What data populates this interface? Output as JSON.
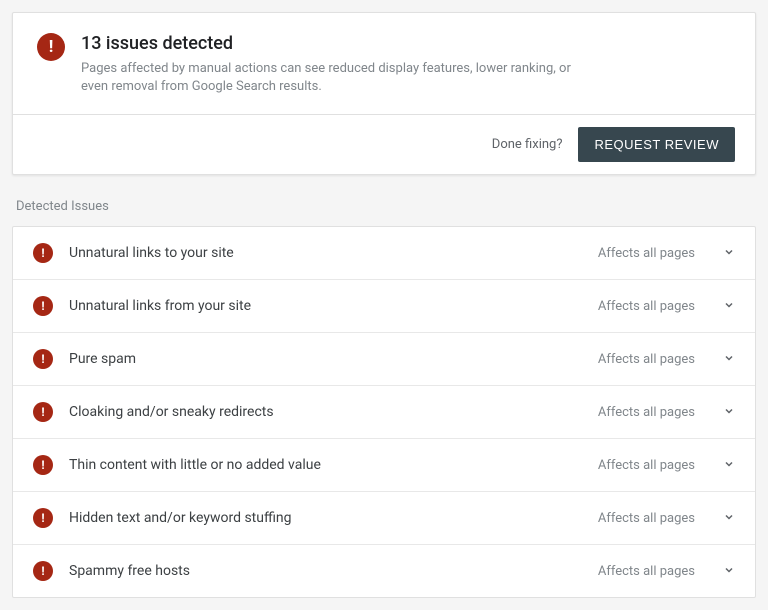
{
  "alert": {
    "title": "13 issues detected",
    "description": "Pages affected by manual actions can see reduced display features, lower ranking, or even removal from Google Search results.",
    "done_fixing_label": "Done fixing?",
    "request_review_label": "REQUEST REVIEW"
  },
  "section_label": "Detected Issues",
  "issues": [
    {
      "label": "Unnatural links to your site",
      "scope": "Affects all pages"
    },
    {
      "label": "Unnatural links from your site",
      "scope": "Affects all pages"
    },
    {
      "label": "Pure spam",
      "scope": "Affects all pages"
    },
    {
      "label": "Cloaking and/or sneaky redirects",
      "scope": "Affects all pages"
    },
    {
      "label": "Thin content with little or no added value",
      "scope": "Affects all pages"
    },
    {
      "label": "Hidden text and/or keyword stuffing",
      "scope": "Affects all pages"
    },
    {
      "label": "Spammy free hosts",
      "scope": "Affects all pages"
    }
  ]
}
